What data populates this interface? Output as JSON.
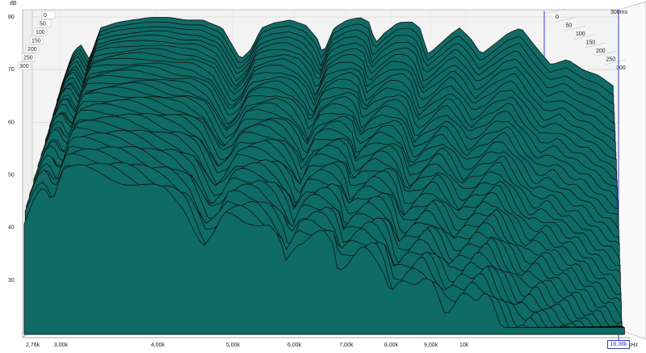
{
  "chart_data": {
    "type": "area",
    "subtype": "waterfall-3d",
    "y_unit": "dB",
    "x_unit": "kHz",
    "t_unit": "ms",
    "ylim": [
      20,
      82
    ],
    "y_ticks": [
      30,
      40,
      50,
      60,
      70,
      80
    ],
    "x_ticks": [
      {
        "label": "2,76k",
        "khz": 2.76
      },
      {
        "label": "3,00k",
        "khz": 3.0
      },
      {
        "label": "4,00k",
        "khz": 4.0
      },
      {
        "label": "5,00k",
        "khz": 5.0
      },
      {
        "label": "6,00k",
        "khz": 6.0
      },
      {
        "label": "7,00k",
        "khz": 7.0
      },
      {
        "label": "8,00k",
        "khz": 8.0
      },
      {
        "label": "9,00k",
        "khz": 9.0
      },
      {
        "label": "10k",
        "khz": 10.0
      }
    ],
    "t_ticks_left": [
      "0",
      "50",
      "100",
      "150",
      "200",
      "250",
      "300"
    ],
    "t_ticks_right": [
      "0",
      "50",
      "100",
      "150",
      "200",
      "250",
      "300"
    ],
    "t_range_label": "300ms",
    "cursor_label": "16,36k",
    "x_range_khz": [
      2.76,
      16.36
    ],
    "t_range_ms": [
      0,
      300
    ],
    "slice_count": 36,
    "fill_color": "#0e6b66",
    "line_color": "#111111",
    "frequency_response_0ms": {
      "khz": [
        2.76,
        2.85,
        2.92,
        3.0,
        3.1,
        3.25,
        3.4,
        3.6,
        3.8,
        4.0,
        4.2,
        4.45,
        4.7,
        4.85,
        5.0,
        5.2,
        5.45,
        5.7,
        5.9,
        6.0,
        6.2,
        6.45,
        6.7,
        6.9,
        7.0,
        7.2,
        7.5,
        7.8,
        8.0,
        8.2,
        8.5,
        8.8,
        9.0,
        9.3,
        9.6,
        10.0,
        10.4,
        10.8,
        11.2,
        11.8,
        12.4,
        13.0,
        13.6,
        14.2
      ],
      "db": [
        66,
        72,
        74,
        71,
        77,
        78,
        78.5,
        79,
        79,
        78.5,
        78.5,
        77,
        71,
        73,
        77,
        78,
        78.5,
        77.5,
        75,
        72,
        77,
        78.5,
        79,
        78,
        74,
        76,
        78,
        78.2,
        77,
        72,
        74,
        76,
        77,
        75,
        72,
        74,
        76,
        77,
        74,
        70,
        71,
        69,
        68,
        66
      ]
    }
  }
}
